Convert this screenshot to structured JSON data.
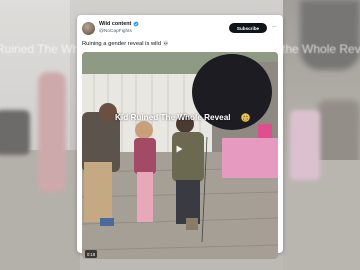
{
  "background": {
    "mirror_text_left": "Ruined The Whole Reveal",
    "mirror_text_right": "the Whole Reveal"
  },
  "tweet": {
    "author_name": "Wild content",
    "handle": "@NoCapFights",
    "subscribe_label": "Subscribe",
    "more_label": "···",
    "text": "Ruining a gender reveal is wild",
    "text_emoji": "💀"
  },
  "video": {
    "overlay_caption": "Kid Ruined The Whole Reveal",
    "duration": "0:18"
  },
  "colors": {
    "verified": "#1d9bf0",
    "subscribe_bg": "#0f1419",
    "balloon": "#1c1c22",
    "table_cloth": "#e79ac0"
  },
  "icons": [
    "avatar",
    "verified-badge-icon",
    "more-icon",
    "skull-emoji-icon",
    "grimace-emoji-icon",
    "play-icon"
  ]
}
